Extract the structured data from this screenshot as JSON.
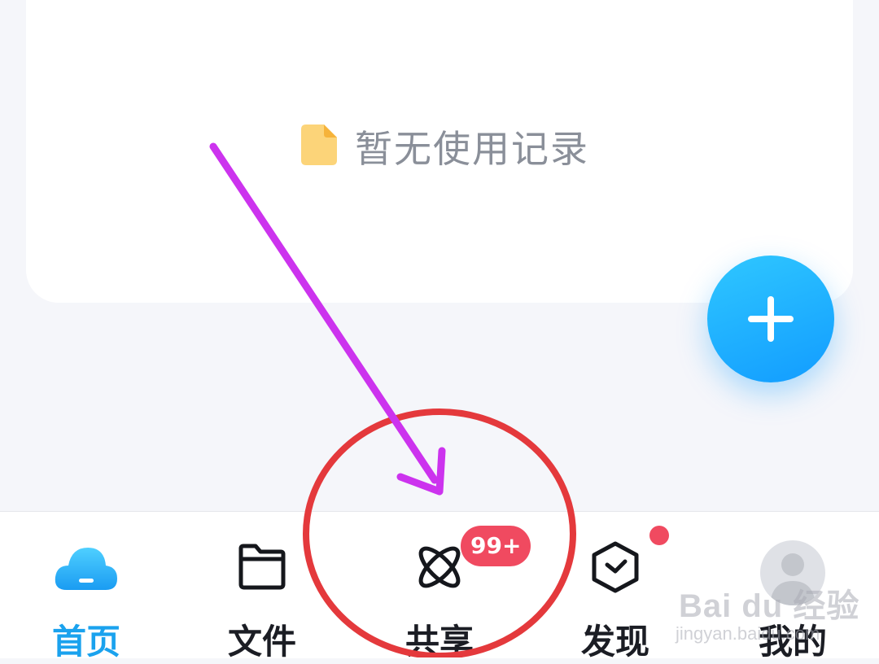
{
  "empty_state": {
    "icon": "document-icon",
    "text": "暂无使用记录"
  },
  "fab": {
    "icon": "plus-icon"
  },
  "tabs": [
    {
      "label": "首页",
      "icon": "cloud-icon",
      "active": true
    },
    {
      "label": "文件",
      "icon": "folder-icon",
      "active": false
    },
    {
      "label": "共享",
      "icon": "atom-icon",
      "active": false,
      "badge": "99+"
    },
    {
      "label": "发现",
      "icon": "cube-icon",
      "active": false,
      "dot": true
    },
    {
      "label": "我的",
      "icon": "avatar-icon",
      "active": false
    }
  ],
  "watermark": {
    "brand": "Bai du 经验",
    "site": "jingyan.baidu.com"
  },
  "colors": {
    "accent": "#1aa2ee",
    "badge": "#f04a60",
    "arrow": "#cc33ee",
    "circle": "#e4393c"
  }
}
